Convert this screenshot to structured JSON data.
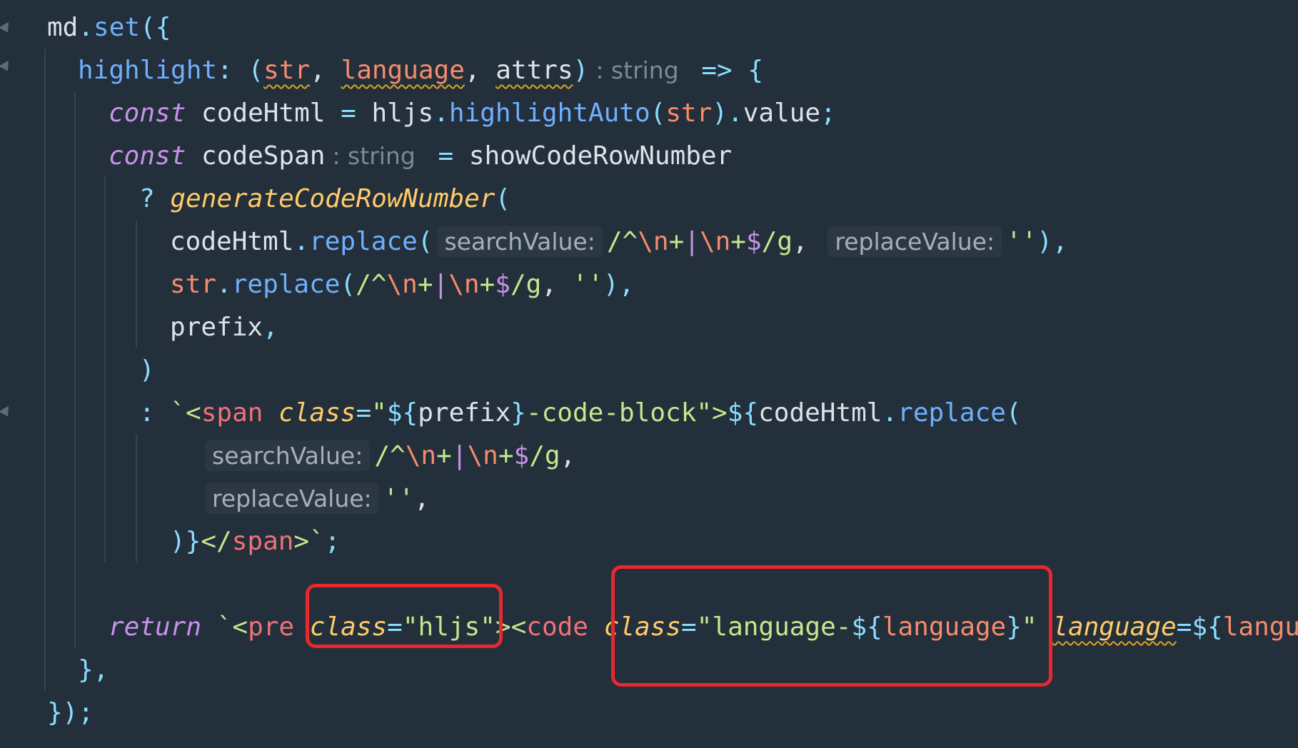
{
  "colors": {
    "background": "#232f3a",
    "plain": "#dbe3ea",
    "method": "#6fb0ff",
    "keyword": "#c792ea",
    "punct": "#89ddff",
    "param": "#f78c6c",
    "string": "#c3e88d",
    "regex_special": "#c792ea",
    "attr": "#ffcb6b",
    "tag": "#f07178",
    "hint_text": "#a4afb9",
    "hint_bg": "#2b3844",
    "highlight_box": "#e8282f"
  },
  "lines": [
    {
      "indent": 0,
      "tokens": [
        {
          "t": "md",
          "c": "plain"
        },
        {
          "t": ".",
          "c": "punct"
        },
        {
          "t": "set",
          "c": "method"
        },
        {
          "t": "({",
          "c": "punct"
        }
      ]
    },
    {
      "indent": 1,
      "tokens": [
        {
          "t": "highlight",
          "c": "method"
        },
        {
          "t": ": ",
          "c": "punct"
        },
        {
          "t": "(",
          "c": "punct"
        },
        {
          "t": "str",
          "c": "param",
          "squig": true
        },
        {
          "t": ", ",
          "c": "plain"
        },
        {
          "t": "language",
          "c": "param",
          "squig": true
        },
        {
          "t": ", ",
          "c": "plain"
        },
        {
          "t": "attrs",
          "c": "plain",
          "squig": true
        },
        {
          "t": ")",
          "c": "punct"
        },
        {
          "t": ": string",
          "k": "typehint"
        },
        {
          "t": " => ",
          "c": "punct"
        },
        {
          "t": "{",
          "c": "punct"
        }
      ]
    },
    {
      "indent": 2,
      "tokens": [
        {
          "t": "const",
          "c": "keyword",
          "italic": true
        },
        {
          "t": " codeHtml ",
          "c": "plain"
        },
        {
          "t": "=",
          "c": "punct"
        },
        {
          "t": " hljs",
          "c": "plain"
        },
        {
          "t": ".",
          "c": "punct"
        },
        {
          "t": "highlightAuto",
          "c": "method"
        },
        {
          "t": "(",
          "c": "punct"
        },
        {
          "t": "str",
          "c": "param"
        },
        {
          "t": ")",
          "c": "punct"
        },
        {
          "t": ".",
          "c": "punct"
        },
        {
          "t": "value",
          "c": "plain"
        },
        {
          "t": ";",
          "c": "punct"
        }
      ]
    },
    {
      "indent": 2,
      "tokens": [
        {
          "t": "const",
          "c": "keyword",
          "italic": true
        },
        {
          "t": " codeSpan",
          "c": "plain"
        },
        {
          "t": ": string",
          "k": "typehint"
        },
        {
          "t": " = ",
          "c": "punct"
        },
        {
          "t": "showCodeRowNumber",
          "c": "plain"
        }
      ]
    },
    {
      "indent": 3,
      "tokens": [
        {
          "t": "? ",
          "c": "punct"
        },
        {
          "t": "generateCodeRowNumber",
          "c": "attr",
          "italic": true
        },
        {
          "t": "(",
          "c": "punct"
        }
      ]
    },
    {
      "indent": 4,
      "tokens": [
        {
          "t": "codeHtml",
          "c": "plain"
        },
        {
          "t": ".",
          "c": "punct"
        },
        {
          "t": "replace",
          "c": "method"
        },
        {
          "t": "(",
          "c": "punct"
        },
        {
          "t": "searchValue:",
          "k": "hint"
        },
        {
          "t": "/^",
          "c": "string"
        },
        {
          "t": "\\n",
          "c": "param"
        },
        {
          "t": "+",
          "c": "string"
        },
        {
          "t": "|",
          "c": "regex_special"
        },
        {
          "t": "\\n",
          "c": "param"
        },
        {
          "t": "+",
          "c": "string"
        },
        {
          "t": "$",
          "c": "regex_special"
        },
        {
          "t": "/g",
          "c": "string"
        },
        {
          "t": ", ",
          "c": "plain"
        },
        {
          "t": "replaceValue:",
          "k": "hint"
        },
        {
          "t": "''",
          "c": "string"
        },
        {
          "t": "),",
          "c": "punct"
        }
      ]
    },
    {
      "indent": 4,
      "tokens": [
        {
          "t": "str",
          "c": "param"
        },
        {
          "t": ".",
          "c": "punct"
        },
        {
          "t": "replace",
          "c": "method"
        },
        {
          "t": "(",
          "c": "punct"
        },
        {
          "t": "/^",
          "c": "string"
        },
        {
          "t": "\\n",
          "c": "param"
        },
        {
          "t": "+",
          "c": "string"
        },
        {
          "t": "|",
          "c": "regex_special"
        },
        {
          "t": "\\n",
          "c": "param"
        },
        {
          "t": "+",
          "c": "string"
        },
        {
          "t": "$",
          "c": "regex_special"
        },
        {
          "t": "/g",
          "c": "string"
        },
        {
          "t": ", ",
          "c": "plain"
        },
        {
          "t": "''",
          "c": "string"
        },
        {
          "t": "),",
          "c": "punct"
        }
      ]
    },
    {
      "indent": 4,
      "tokens": [
        {
          "t": "prefix",
          "c": "plain"
        },
        {
          "t": ",",
          "c": "punct"
        }
      ]
    },
    {
      "indent": 3,
      "tokens": [
        {
          "t": ")",
          "c": "punct"
        }
      ]
    },
    {
      "indent": 3,
      "tokens": [
        {
          "t": ": ",
          "c": "punct"
        },
        {
          "t": "`<",
          "c": "string"
        },
        {
          "t": "span",
          "c": "tag"
        },
        {
          "t": " ",
          "c": "plain"
        },
        {
          "t": "class",
          "c": "attr",
          "italic": true
        },
        {
          "t": "=",
          "c": "punct"
        },
        {
          "t": "\"",
          "c": "string"
        },
        {
          "t": "${",
          "c": "punct"
        },
        {
          "t": "prefix",
          "c": "plain"
        },
        {
          "t": "}",
          "c": "punct"
        },
        {
          "t": "-code-block\"",
          "c": "string"
        },
        {
          "t": ">",
          "c": "string"
        },
        {
          "t": "${",
          "c": "punct"
        },
        {
          "t": "codeHtml",
          "c": "plain"
        },
        {
          "t": ".",
          "c": "punct"
        },
        {
          "t": "replace",
          "c": "method"
        },
        {
          "t": "(",
          "c": "punct"
        }
      ]
    },
    {
      "indent": 5,
      "tokens": [
        {
          "t": "searchValue:",
          "k": "hint"
        },
        {
          "t": "/^",
          "c": "string"
        },
        {
          "t": "\\n",
          "c": "param"
        },
        {
          "t": "+",
          "c": "string"
        },
        {
          "t": "|",
          "c": "regex_special"
        },
        {
          "t": "\\n",
          "c": "param"
        },
        {
          "t": "+",
          "c": "string"
        },
        {
          "t": "$",
          "c": "regex_special"
        },
        {
          "t": "/g",
          "c": "string"
        },
        {
          "t": ",",
          "c": "plain"
        }
      ]
    },
    {
      "indent": 5,
      "tokens": [
        {
          "t": "replaceValue:",
          "k": "hint"
        },
        {
          "t": "''",
          "c": "string"
        },
        {
          "t": ",",
          "c": "plain"
        }
      ]
    },
    {
      "indent": 4,
      "tokens": [
        {
          "t": ")}",
          "c": "punct"
        },
        {
          "t": "</",
          "c": "string"
        },
        {
          "t": "span",
          "c": "tag"
        },
        {
          "t": ">`",
          "c": "string"
        },
        {
          "t": ";",
          "c": "punct"
        }
      ]
    },
    {
      "indent": 0,
      "tokens": []
    },
    {
      "indent": 2,
      "tokens": [
        {
          "t": "return",
          "c": "keyword",
          "italic": true
        },
        {
          "t": " `<",
          "c": "string"
        },
        {
          "t": "pre",
          "c": "tag"
        },
        {
          "t": " ",
          "c": "plain"
        },
        {
          "t": "class",
          "c": "attr",
          "italic": true
        },
        {
          "t": "=",
          "c": "punct"
        },
        {
          "t": "\"hljs\"",
          "c": "string"
        },
        {
          "t": "><",
          "c": "string"
        },
        {
          "t": "code",
          "c": "tag"
        },
        {
          "t": " ",
          "c": "plain"
        },
        {
          "t": "class",
          "c": "attr",
          "italic": true
        },
        {
          "t": "=",
          "c": "punct"
        },
        {
          "t": "\"language-",
          "c": "string"
        },
        {
          "t": "${",
          "c": "punct"
        },
        {
          "t": "language",
          "c": "param"
        },
        {
          "t": "}",
          "c": "punct"
        },
        {
          "t": "\"",
          "c": "string"
        },
        {
          "t": " ",
          "c": "plain"
        },
        {
          "t": "language",
          "c": "attr",
          "italic": true,
          "squig": true
        },
        {
          "t": "=",
          "c": "punct"
        },
        {
          "t": "${",
          "c": "punct"
        },
        {
          "t": "langu",
          "c": "param"
        }
      ]
    },
    {
      "indent": 1,
      "tokens": [
        {
          "t": "},",
          "c": "punct"
        }
      ]
    },
    {
      "indent": 0,
      "tokens": [
        {
          "t": "});",
          "c": "punct"
        }
      ]
    }
  ]
}
